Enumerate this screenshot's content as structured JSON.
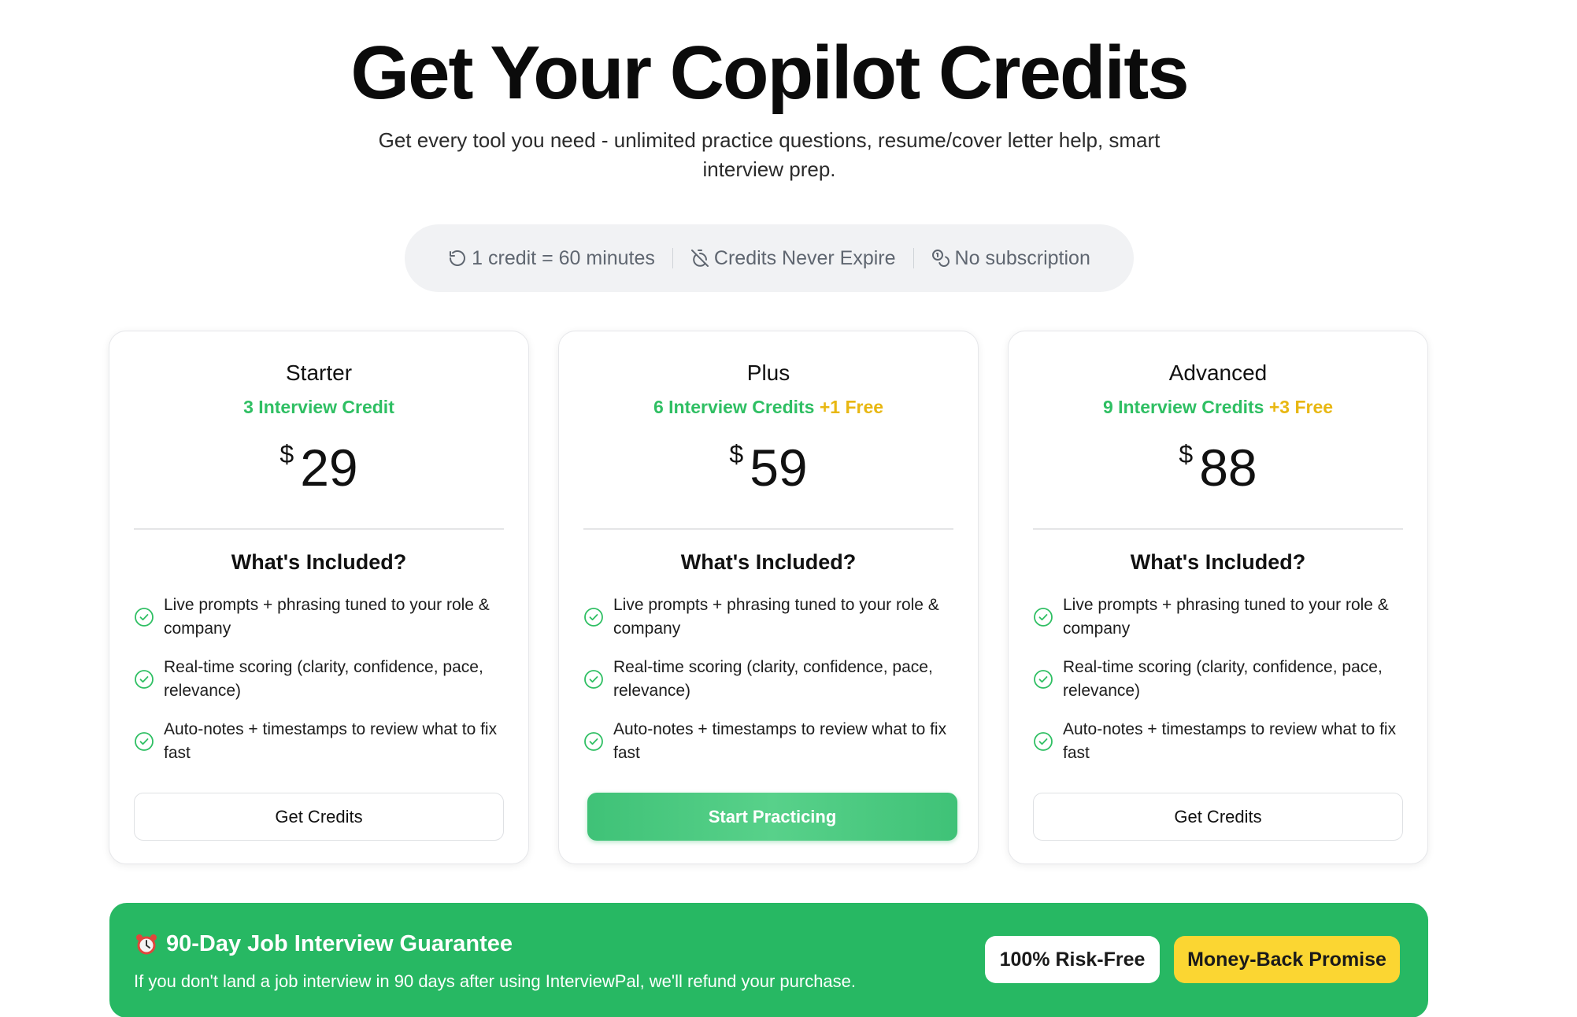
{
  "header": {
    "title": "Get Your Copilot Credits",
    "subtitle": "Get every tool you need - unlimited practice questions, resume/cover letter help, smart interview prep."
  },
  "highlights": [
    {
      "icon": "rotate-ccw-icon",
      "label": "1 credit = 60 minutes"
    },
    {
      "icon": "timer-off-icon",
      "label": "Credits Never Expire"
    },
    {
      "icon": "coins-icon",
      "label": "No subscription"
    }
  ],
  "plans": [
    {
      "name": "Starter",
      "credits": "3 Interview Credit",
      "bonus": "",
      "currency": "$",
      "price": "29",
      "included_title": "What's Included?",
      "features": [
        "Live prompts + phrasing tuned to your role & company",
        "Real-time scoring (clarity, confidence, pace, relevance)",
        "Auto-notes + timestamps to review what to fix fast"
      ],
      "button": "Get Credits"
    },
    {
      "name": "Plus",
      "credits": "6 Interview Credits",
      "bonus": "+1 Free",
      "currency": "$",
      "price": "59",
      "included_title": "What's Included?",
      "features": [
        "Live prompts + phrasing tuned to your role & company",
        "Real-time scoring (clarity, confidence, pace, relevance)",
        "Auto-notes + timestamps to review what to fix fast"
      ],
      "button": "Start Practicing"
    },
    {
      "name": "Advanced",
      "credits": "9 Interview Credits",
      "bonus": "+3 Free",
      "currency": "$",
      "price": "88",
      "included_title": "What's Included?",
      "features": [
        "Live prompts + phrasing tuned to your role & company",
        "Real-time scoring (clarity, confidence, pace, relevance)",
        "Auto-notes + timestamps to review what to fix fast"
      ],
      "button": "Get Credits"
    }
  ],
  "guarantee": {
    "icon": "alarm-clock-icon",
    "title": "90-Day Job Interview Guarantee",
    "description": "If you don't land a job interview in 90 days after using InterviewPal, we'll refund your purchase.",
    "badge_risk_free": "100% Risk-Free",
    "badge_money_back": "Money-Back Promise"
  },
  "colors": {
    "accent_green": "#2fbf63",
    "bonus_yellow": "#e8b712",
    "banner_green": "#27b863",
    "badge_yellow": "#fbd632"
  }
}
